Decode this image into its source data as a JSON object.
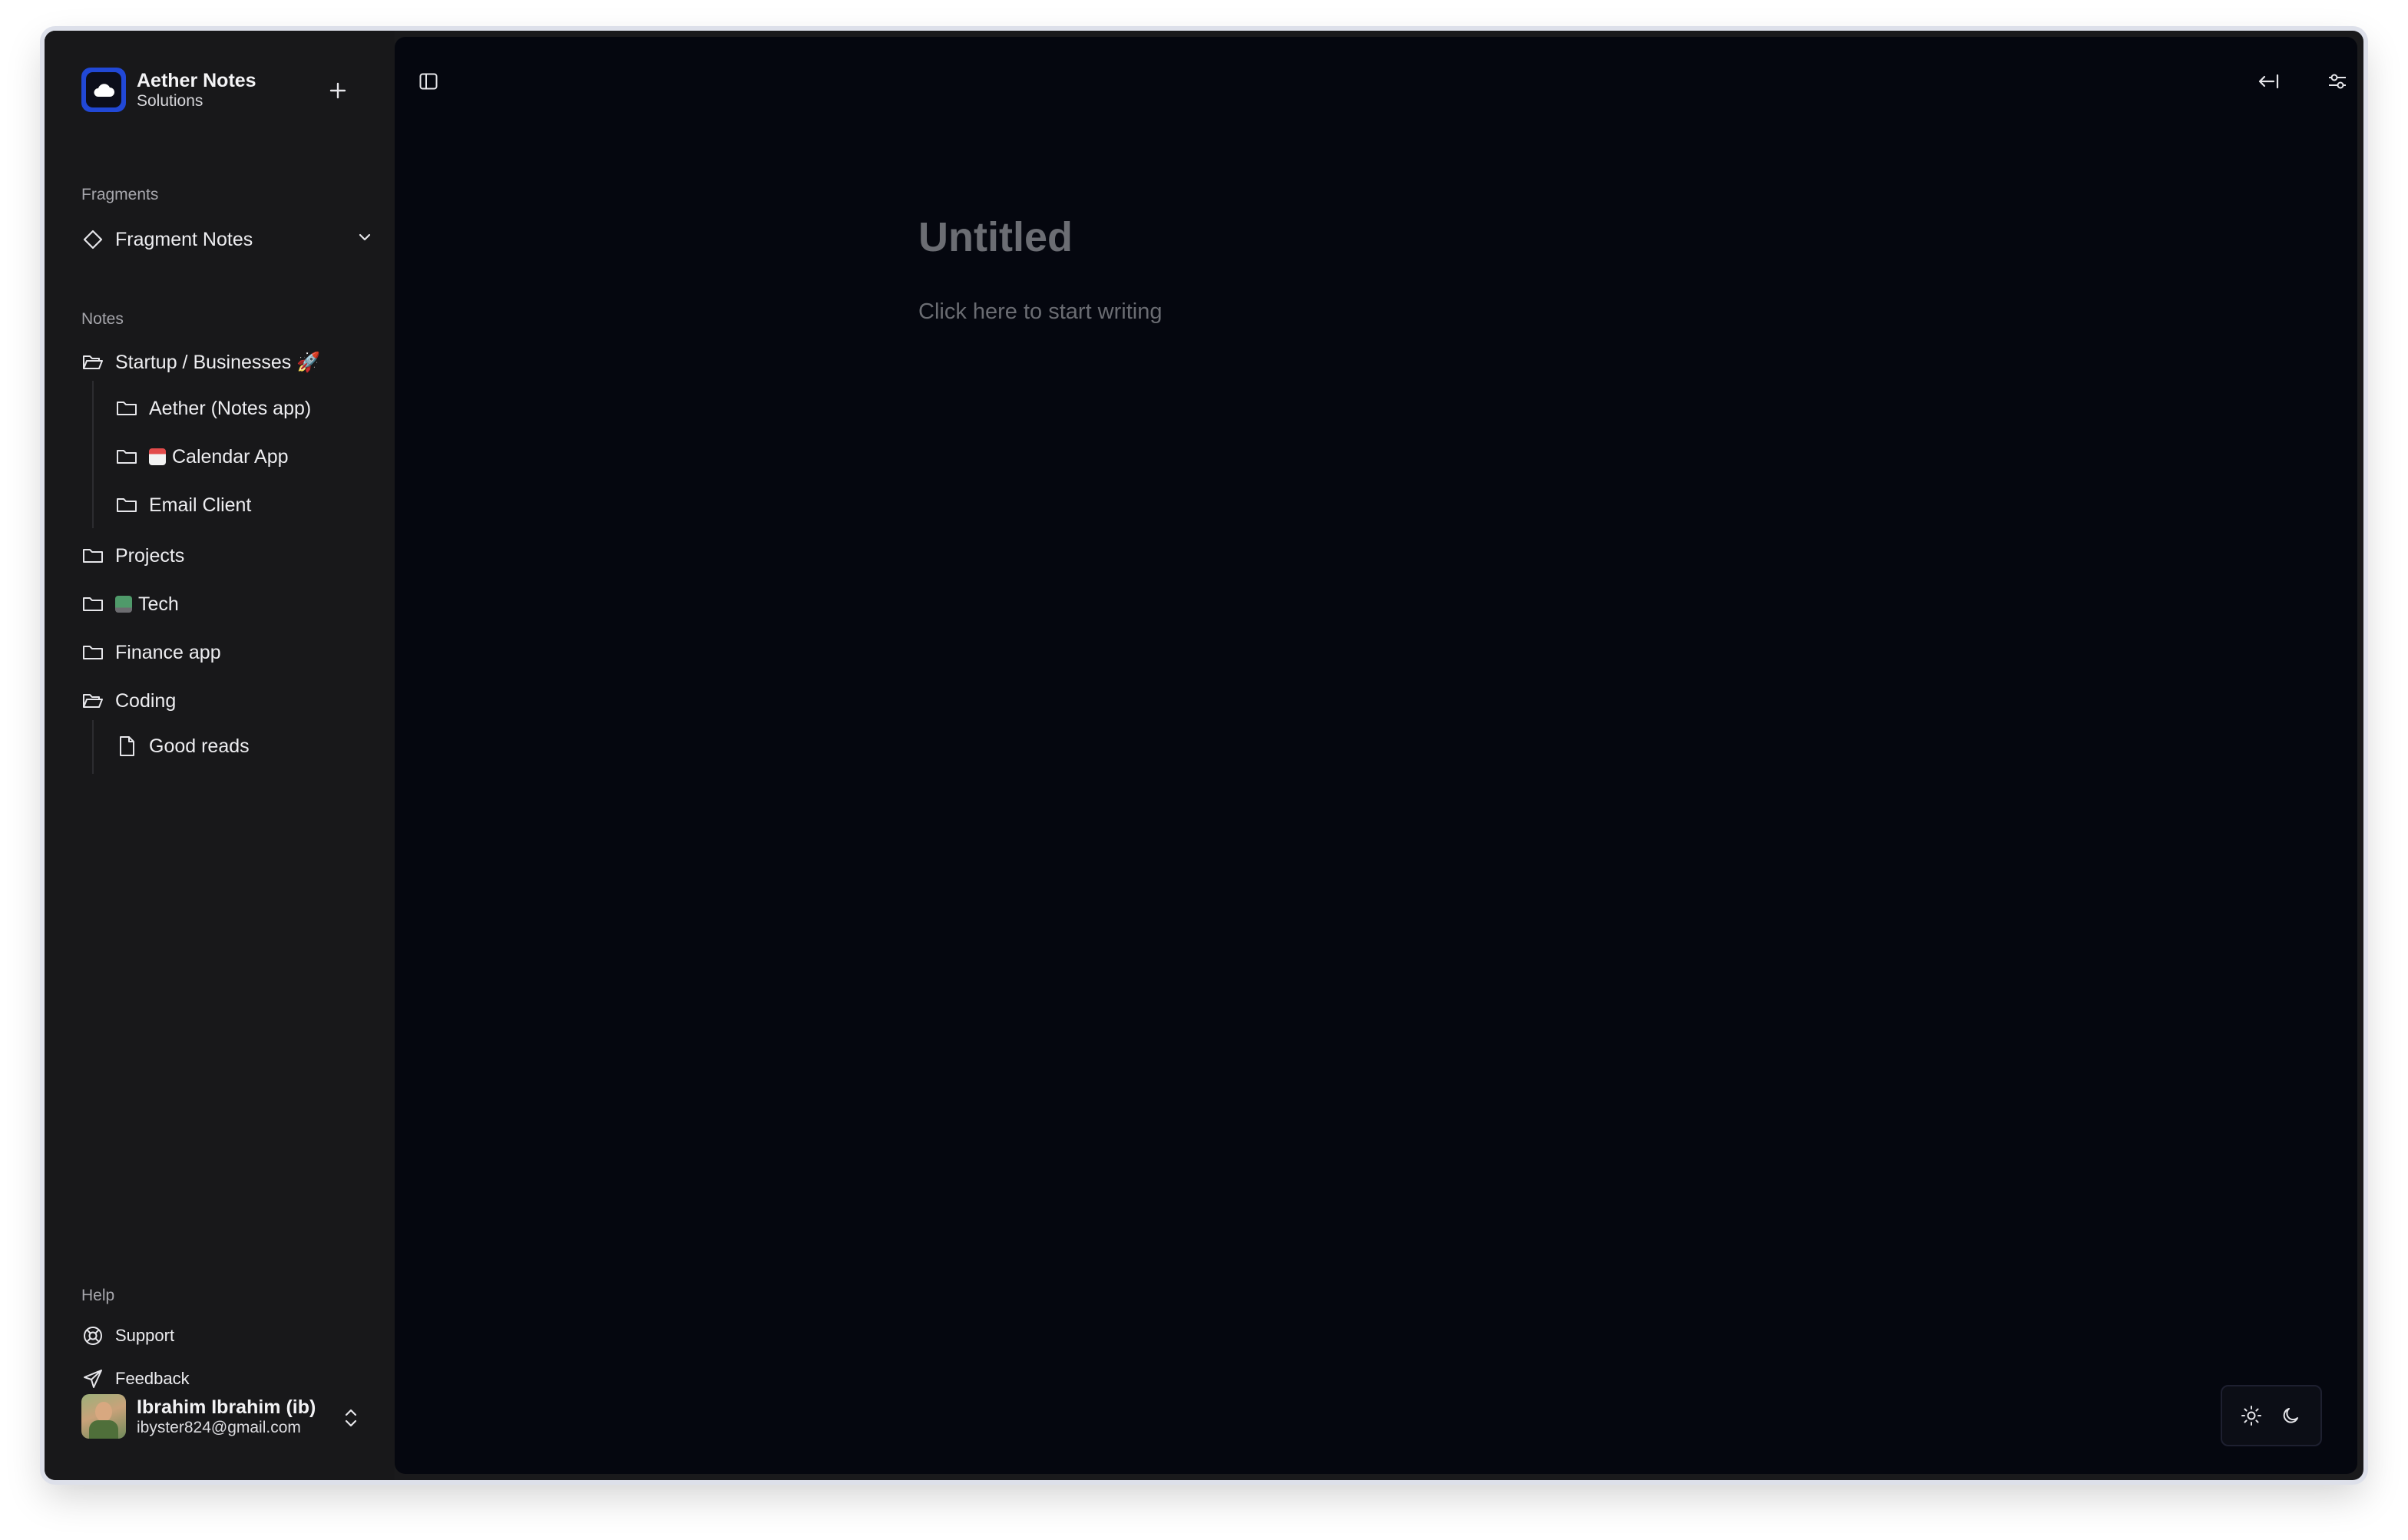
{
  "brand": {
    "name": "Aether Notes",
    "subtitle": "Solutions"
  },
  "sidebar": {
    "fragments_label": "Fragments",
    "fragment_item": "Fragment Notes",
    "notes_label": "Notes",
    "folders": {
      "startup": "Startup / Businesses 🚀",
      "aether": "Aether (Notes app)",
      "calendar": "Calendar App",
      "email": "Email Client",
      "projects": "Projects",
      "tech": "Tech",
      "finance": "Finance app",
      "coding": "Coding",
      "good_reads": "Good reads"
    },
    "help_label": "Help",
    "support": "Support",
    "feedback": "Feedback"
  },
  "user": {
    "name": "Ibrahim Ibrahim (ib)",
    "email": "ibyster824@gmail.com"
  },
  "editor": {
    "title_placeholder": "Untitled",
    "body_placeholder": "Click here to start writing"
  },
  "colors": {
    "accent": "#2148d6",
    "sidebar_bg": "#18181a",
    "editor_bg": "#05070f"
  }
}
